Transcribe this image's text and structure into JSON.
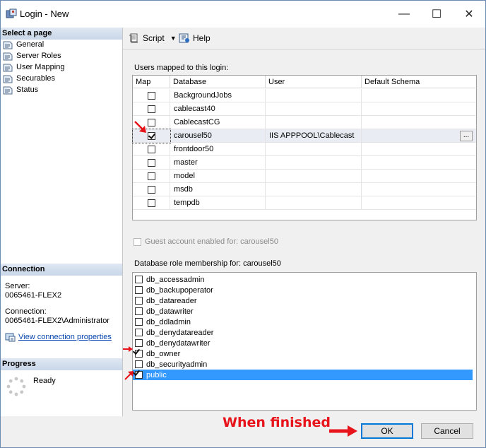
{
  "window": {
    "title": "Login - New",
    "minimize": "—",
    "maximize": "☐",
    "close": "✕"
  },
  "sidebar": {
    "select_page_header": "Select a page",
    "pages": [
      {
        "label": "General"
      },
      {
        "label": "Server Roles"
      },
      {
        "label": "User Mapping"
      },
      {
        "label": "Securables"
      },
      {
        "label": "Status"
      }
    ],
    "connection_header": "Connection",
    "server_label": "Server:",
    "server_value": "0065461-FLEX2",
    "connection_label": "Connection:",
    "connection_value": "0065461-FLEX2\\Administrator",
    "view_connection_link": "View connection properties",
    "progress_header": "Progress",
    "progress_status": "Ready"
  },
  "toolbar": {
    "script_label": "Script",
    "help_label": "Help"
  },
  "mapping": {
    "section_label": "Users mapped to this login:",
    "columns": [
      "Map",
      "Database",
      "User",
      "Default Schema"
    ],
    "rows": [
      {
        "checked": false,
        "database": "BackgroundJobs",
        "user": "",
        "schema": ""
      },
      {
        "checked": false,
        "database": "cablecast40",
        "user": "",
        "schema": ""
      },
      {
        "checked": false,
        "database": "CablecastCG",
        "user": "",
        "schema": ""
      },
      {
        "checked": true,
        "database": "carousel50",
        "user": "IIS APPPOOL\\Cablecast",
        "schema": "",
        "ellipsis": "..."
      },
      {
        "checked": false,
        "database": "frontdoor50",
        "user": "",
        "schema": ""
      },
      {
        "checked": false,
        "database": "master",
        "user": "",
        "schema": ""
      },
      {
        "checked": false,
        "database": "model",
        "user": "",
        "schema": ""
      },
      {
        "checked": false,
        "database": "msdb",
        "user": "",
        "schema": ""
      },
      {
        "checked": false,
        "database": "tempdb",
        "user": "",
        "schema": ""
      }
    ]
  },
  "guest": {
    "label": "Guest account enabled for: carousel50",
    "checked": false
  },
  "roles": {
    "section_label": "Database role membership for: carousel50",
    "items": [
      {
        "label": "db_accessadmin",
        "checked": false
      },
      {
        "label": "db_backupoperator",
        "checked": false
      },
      {
        "label": "db_datareader",
        "checked": false
      },
      {
        "label": "db_datawriter",
        "checked": false
      },
      {
        "label": "db_ddladmin",
        "checked": false
      },
      {
        "label": "db_denydatareader",
        "checked": false
      },
      {
        "label": "db_denydatawriter",
        "checked": false
      },
      {
        "label": "db_owner",
        "checked": true
      },
      {
        "label": "db_securityadmin",
        "checked": false
      },
      {
        "label": "public",
        "checked": true,
        "selected": true
      }
    ]
  },
  "annotation": {
    "text": "When finished",
    "color": "#e8141b"
  },
  "buttons": {
    "ok": "OK",
    "cancel": "Cancel"
  }
}
